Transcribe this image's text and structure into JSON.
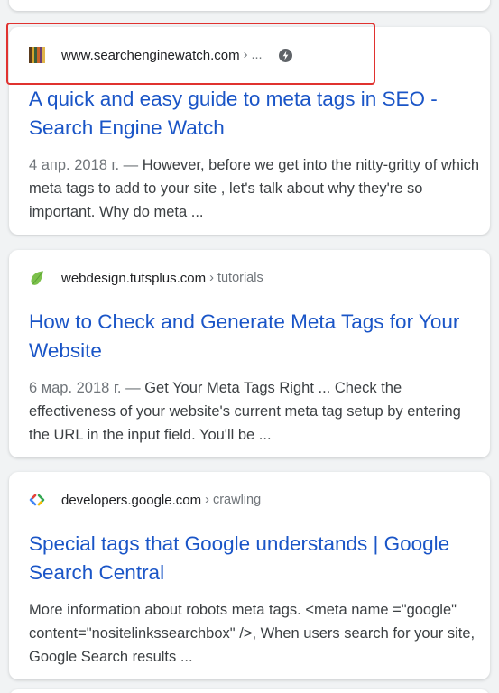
{
  "results": [
    {
      "domain": "www.searchenginewatch.com",
      "path": "› ...",
      "title": "A quick and easy guide to meta tags in SEO - Search Engine Watch",
      "date": "4 апр. 2018 г. —",
      "snippet": "However, before we get into the nitty-gritty of which meta tags to add to your site , let's talk about why they're so important. Why do meta ...",
      "favicon_icon": "striped-bars-favicon",
      "has_amp": true
    },
    {
      "domain": "webdesign.tutsplus.com",
      "path": "› tutorials",
      "title": "How to Check and Generate Meta Tags for Your Website",
      "date": "6 мар. 2018 г. —",
      "snippet": "Get Your Meta Tags Right ... Check the effectiveness of your website's current meta tag setup by entering the URL in the input field. You'll be ...",
      "favicon_icon": "green-leaf-favicon"
    },
    {
      "domain": "developers.google.com",
      "path": "› crawling",
      "title": "Special tags that Google understands | Google Search Central",
      "date": "",
      "snippet": "More information about robots meta tags. <meta name =\"google\" content=\"nositelinkssearchbox\" />, When users search for your site, Google Search results ...",
      "favicon_icon": "code-brackets-favicon"
    }
  ],
  "colors": {
    "title_link": "#1a55c7",
    "highlight_border": "#e0322f",
    "page_background": "#f1f3f4"
  }
}
